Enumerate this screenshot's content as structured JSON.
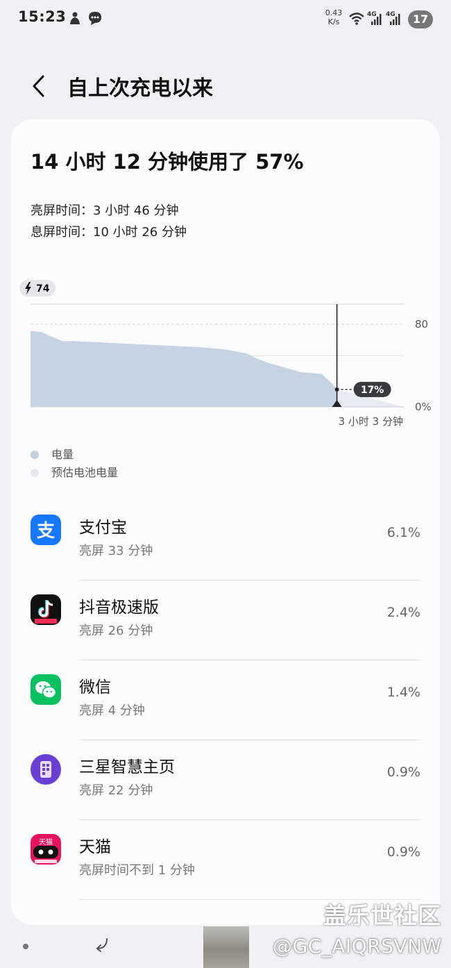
{
  "status_bar": {
    "time": "15:23",
    "net_speed_value": "0.43",
    "net_speed_unit": "K/s",
    "signal_1_label": "4G",
    "signal_2_label": "4G",
    "battery_level": "17"
  },
  "header": {
    "back_icon": "chevron-left-icon",
    "title": "自上次充电以来"
  },
  "summary": {
    "headline": "14 小时 12 分钟使用了 57%",
    "screen_on": "亮屏时间：3 小时 46 分钟",
    "screen_off": "息屏时间：10 小时 26 分钟"
  },
  "chart_data": {
    "type": "area",
    "x": [
      0,
      0.5,
      1,
      1.5,
      2,
      3,
      4,
      5,
      6,
      7,
      8,
      9,
      10,
      10.5,
      11,
      11.5,
      12,
      12.5,
      13,
      13.5,
      14,
      14.2
    ],
    "y": [
      74,
      73,
      68,
      64,
      64,
      63,
      62,
      61,
      60,
      59,
      58,
      56,
      52,
      47,
      43,
      40,
      37,
      34,
      33,
      32,
      22,
      17
    ],
    "forecast_x": [
      14.2,
      17.3
    ],
    "forecast_y": [
      17,
      0
    ],
    "ylim": [
      0,
      100
    ],
    "y_ticks": [
      "80",
      "0%"
    ],
    "start_label": "74",
    "current_label": "17%",
    "remaining_label": "3 小时 3 分钟",
    "legend": [
      {
        "label": "电量",
        "color": "#c2d0e0"
      },
      {
        "label": "预估电池电量",
        "color": "#e6eaf0"
      }
    ],
    "colors": {
      "area": "#c6d3e3",
      "forecast": "#e8ecf2"
    }
  },
  "apps": [
    {
      "name": "支付宝",
      "usage": "亮屏 33 分钟",
      "percent": "6.1%",
      "icon": "alipay-icon",
      "icon_char": "支",
      "color": "#1677ff"
    },
    {
      "name": "抖音极速版",
      "usage": "亮屏 26 分钟",
      "percent": "2.4%",
      "icon": "douyin-lite-icon",
      "color": "#111111"
    },
    {
      "name": "微信",
      "usage": "亮屏 4 分钟",
      "percent": "1.4%",
      "icon": "wechat-icon",
      "color": "#07c160"
    },
    {
      "name": "三星智慧主页",
      "usage": "亮屏 22 分钟",
      "percent": "0.9%",
      "icon": "samsung-free-icon",
      "color": "#6a3fd4"
    },
    {
      "name": "天猫",
      "usage": "亮屏时间不到 1 分钟",
      "percent": "0.9%",
      "icon": "tmall-icon",
      "icon_char": "天猫",
      "color": "#e8135e"
    }
  ],
  "watermark": {
    "site": "盖乐世社区",
    "user": "@GC_AIQRSVNW"
  }
}
